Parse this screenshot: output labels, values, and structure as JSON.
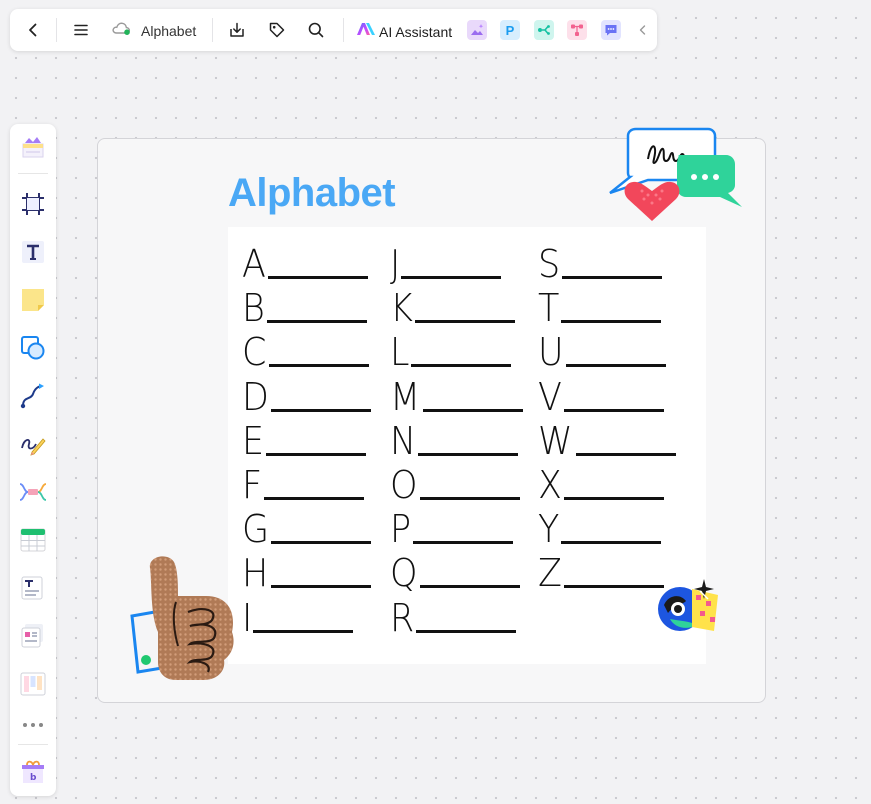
{
  "toolbar": {
    "title": "Alphabet",
    "ai_label": "AI Assistant",
    "icons": [
      "back-icon",
      "menu-icon",
      "cloud-icon",
      "download-icon",
      "tag-icon",
      "search-icon"
    ],
    "app_tiles": [
      {
        "name": "image-ai-app",
        "color": "#e9d9fb"
      },
      {
        "name": "presentation-app",
        "color": "#d7eefe"
      },
      {
        "name": "mindmap-app",
        "color": "#cff5ee"
      },
      {
        "name": "flowchart-app",
        "color": "#fde0ea"
      },
      {
        "name": "chat-app",
        "color": "#e2e4ff"
      }
    ]
  },
  "sidebar": {
    "items": [
      "templates-tool",
      "frame-tool",
      "text-tool",
      "sticky-note-tool",
      "shape-tool",
      "connector-tool",
      "pen-tool",
      "mindmap-tool",
      "table-tool",
      "text-block-tool",
      "card-tool",
      "kanban-tool",
      "more-tools",
      "materials-box"
    ]
  },
  "canvas": {
    "title": "Alphabet",
    "title_color": "#4aa8f5",
    "columns": [
      [
        "A",
        "B",
        "C",
        "D",
        "E",
        "F",
        "G",
        "H",
        "I"
      ],
      [
        "J",
        "K",
        "L",
        "M",
        "N",
        "O",
        "P",
        "Q",
        "R"
      ],
      [
        "S",
        "T",
        "U",
        "V",
        "W",
        "X",
        "Y",
        "Z"
      ]
    ]
  }
}
